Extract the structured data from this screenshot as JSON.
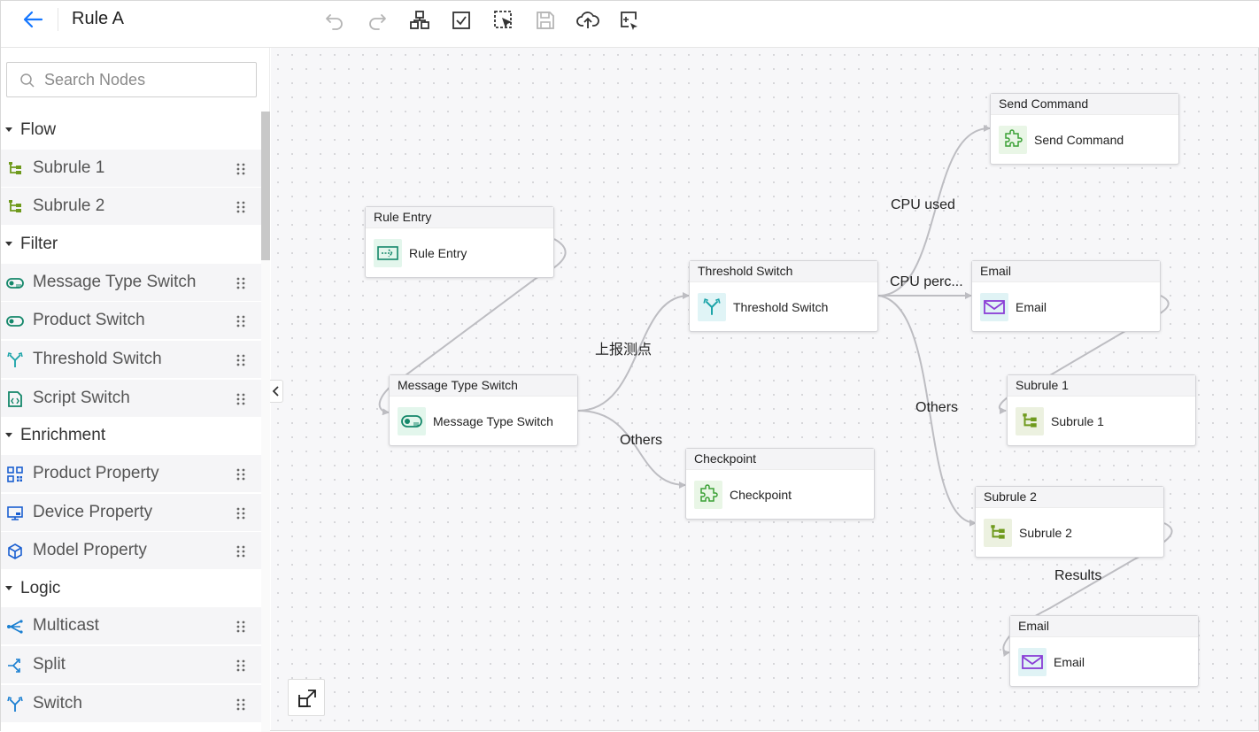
{
  "header": {
    "title": "Rule A",
    "tools": [
      "undo-icon",
      "redo-icon",
      "auto-layout-icon",
      "validate-icon",
      "select-area-icon",
      "save-icon",
      "upload-icon",
      "add-node-icon"
    ]
  },
  "sidebar": {
    "search_placeholder": "Search Nodes",
    "groups": [
      {
        "label": "Flow",
        "items": [
          {
            "label": "Subrule 1",
            "icon": "subrule-icon"
          },
          {
            "label": "Subrule 2",
            "icon": "subrule-icon"
          }
        ]
      },
      {
        "label": "Filter",
        "items": [
          {
            "label": "Message Type Switch",
            "icon": "toggle-switch-icon"
          },
          {
            "label": "Product Switch",
            "icon": "toggle-switch-icon"
          },
          {
            "label": "Threshold Switch",
            "icon": "fork-icon"
          },
          {
            "label": "Script Switch",
            "icon": "script-icon"
          }
        ]
      },
      {
        "label": "Enrichment",
        "items": [
          {
            "label": "Product Property",
            "icon": "grid-icon"
          },
          {
            "label": "Device Property",
            "icon": "monitor-icon"
          },
          {
            "label": "Model Property",
            "icon": "cube-icon"
          }
        ]
      },
      {
        "label": "Logic",
        "items": [
          {
            "label": "Multicast",
            "icon": "multicast-icon"
          },
          {
            "label": "Split",
            "icon": "split-icon"
          },
          {
            "label": "Switch",
            "icon": "fork-icon"
          }
        ]
      }
    ]
  },
  "canvas": {
    "nodes": {
      "send_command": {
        "title": "Send Command",
        "label": "Send Command",
        "icon": "puzzle-icon"
      },
      "rule_entry": {
        "title": "Rule Entry",
        "label": "Rule Entry",
        "icon": "entry-icon"
      },
      "threshold_switch": {
        "title": "Threshold Switch",
        "label": "Threshold Switch",
        "icon": "fork-icon"
      },
      "email_1": {
        "title": "Email",
        "label": "Email",
        "icon": "mail-icon"
      },
      "message_type_switch": {
        "title": "Message Type Switch",
        "label": "Message Type Switch",
        "icon": "toggle-switch-icon"
      },
      "subrule_1": {
        "title": "Subrule 1",
        "label": "Subrule 1",
        "icon": "subrule-icon"
      },
      "checkpoint": {
        "title": "Checkpoint",
        "label": "Checkpoint",
        "icon": "puzzle-icon"
      },
      "subrule_2": {
        "title": "Subrule 2",
        "label": "Subrule 2",
        "icon": "subrule-icon"
      },
      "email_2": {
        "title": "Email",
        "label": "Email",
        "icon": "mail-icon"
      }
    },
    "edge_labels": {
      "cpu_used": "CPU used",
      "cpu_perc": "CPU perc...",
      "report_point": "上报测点",
      "others_1": "Others",
      "others_2": "Others",
      "results": "Results"
    }
  },
  "colors": {
    "accent": "#1677ff",
    "edge": "#bdbdc2",
    "green_icon": "#2e9e5b",
    "teal_icon": "#1aa3a8",
    "mail_icon": "#8a3ed6",
    "olive_icon": "#6f9a1d"
  }
}
